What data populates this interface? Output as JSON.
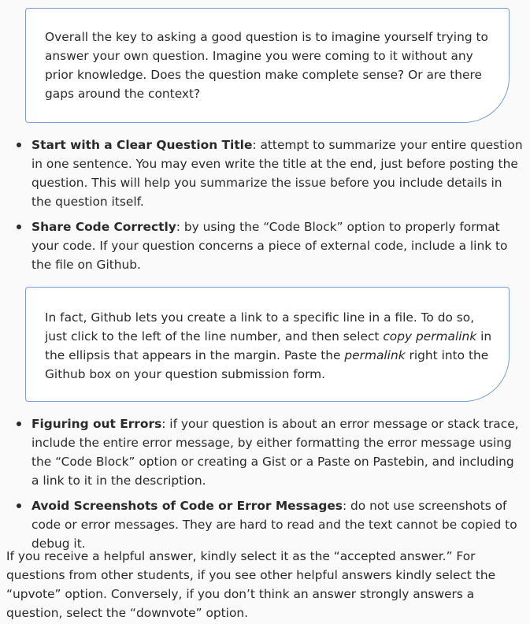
{
  "callout_1": {
    "text": "Overall the key to asking a good question is to imagine yourself trying to answer your own question. Imagine you were coming to it without any prior knowledge. Does the question make complete sense? Or are there gaps around the context?"
  },
  "tips_1": [
    {
      "title": "Start with a Clear Question Title",
      "text": ": attempt to summarize your entire question in one sentence. You may even write the title at the end, just before posting the question. This will help you summarize the issue before you include details in the question itself."
    },
    {
      "title": "Share Code Correctly",
      "text": ": by using the “Code Block” option to properly format your code. If your question concerns a piece of external code, include a link to the file on Github."
    }
  ],
  "callout_2": {
    "part1": "In fact, Github lets you create a link to a specific line in a file. To do so, just click to the left of the line number, and then select ",
    "em1": "copy permalink",
    "part2": " in the ellipsis that appears in the margin. Paste the ",
    "em2": "permalink",
    "part3": " right into the Github box on your question submission form."
  },
  "tips_2": [
    {
      "title": "Figuring out Errors",
      "text": ": if your question is about an error message or stack trace, include the entire error message, by either formatting the error message using the “Code Block” option or creating a Gist or a Paste on Pastebin, and including a link to it in the description."
    },
    {
      "title": "Avoid Screenshots of Code or Error Messages",
      "text": ": do not use screenshots of code or error messages. They are hard to read and the text cannot be copied to debug it."
    }
  ],
  "closing": {
    "text": "If you receive a helpful answer, kindly select it as the “accepted answer.” For questions from other students, if you see other helpful answers kindly select the “upvote” option. Conversely, if you don’t think an answer strongly answers a question, select the “downvote” option."
  }
}
